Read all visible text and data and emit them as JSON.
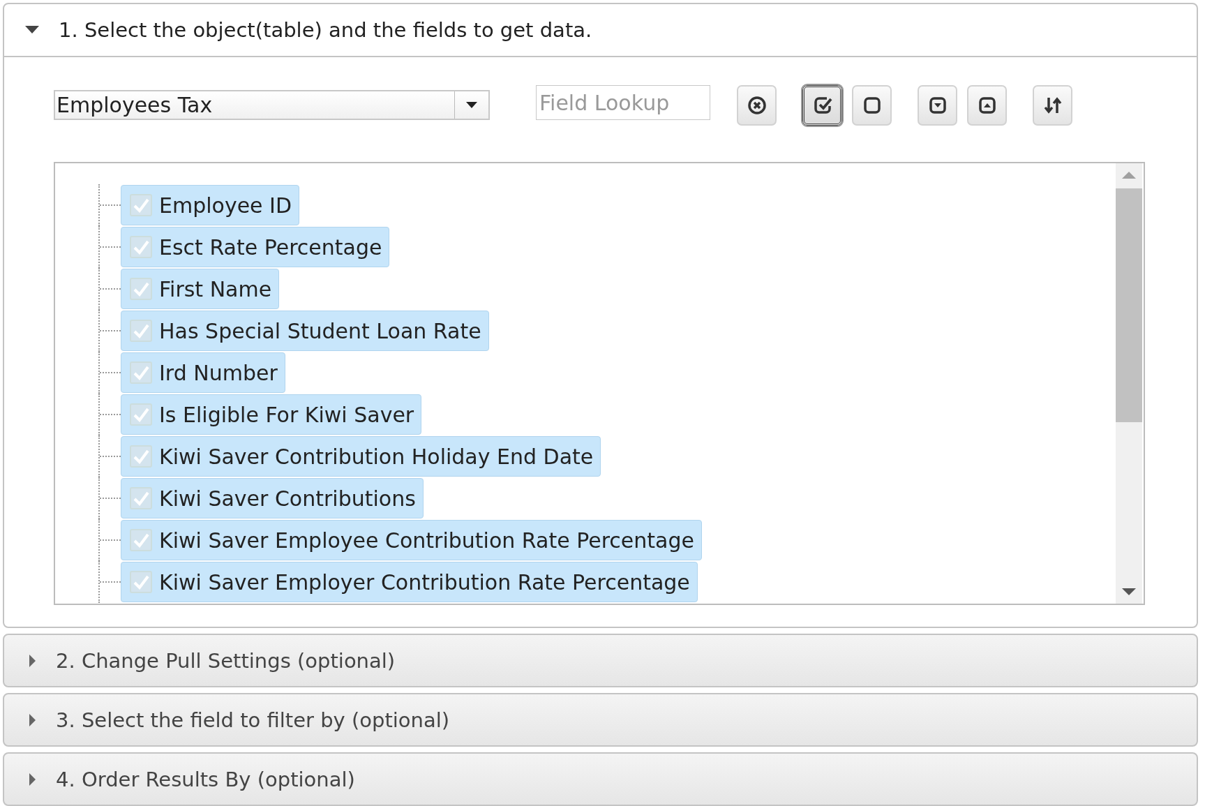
{
  "panels": [
    {
      "title": "1. Select the object(table) and the fields to get data.",
      "expanded": true,
      "object_select": {
        "value": "Employees Tax"
      },
      "field_lookup": {
        "placeholder": "Field Lookup"
      },
      "toolbar": [
        {
          "kind": "clear",
          "pressed": false
        },
        {
          "kind": "check-all",
          "pressed": true
        },
        {
          "kind": "uncheck-all",
          "pressed": false
        },
        {
          "kind": "expand",
          "pressed": false
        },
        {
          "kind": "collapse",
          "pressed": false
        },
        {
          "kind": "sort",
          "pressed": false
        }
      ],
      "fields": [
        {
          "label": "Employee ID",
          "checked": true
        },
        {
          "label": "Esct Rate Percentage",
          "checked": true
        },
        {
          "label": "First Name",
          "checked": true
        },
        {
          "label": "Has Special Student Loan Rate",
          "checked": true
        },
        {
          "label": "Ird Number",
          "checked": true
        },
        {
          "label": "Is Eligible For Kiwi Saver",
          "checked": true
        },
        {
          "label": "Kiwi Saver Contribution Holiday End Date",
          "checked": true
        },
        {
          "label": "Kiwi Saver Contributions",
          "checked": true
        },
        {
          "label": "Kiwi Saver Employee Contribution Rate Percentage",
          "checked": true
        },
        {
          "label": "Kiwi Saver Employer Contribution Rate Percentage",
          "checked": true
        }
      ]
    },
    {
      "title": "2. Change Pull Settings (optional)",
      "expanded": false
    },
    {
      "title": "3. Select the field to filter by (optional)",
      "expanded": false
    },
    {
      "title": "4. Order Results By (optional)",
      "expanded": false
    }
  ]
}
